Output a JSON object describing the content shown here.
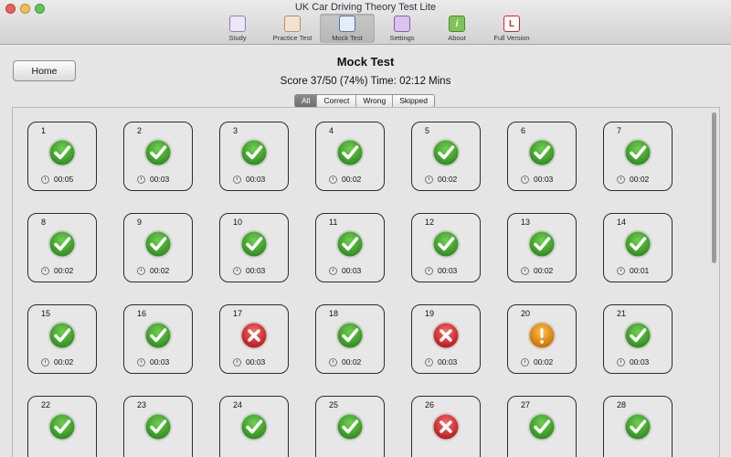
{
  "window": {
    "title": "UK Car Driving Theory Test Lite"
  },
  "toolbar": [
    {
      "label": "Study",
      "icon": "book-icon",
      "active": false
    },
    {
      "label": "Practice Test",
      "icon": "clipboard-icon",
      "active": false
    },
    {
      "label": "Mock Test",
      "icon": "stopwatch-icon",
      "active": true
    },
    {
      "label": "Settings",
      "icon": "gear-icon",
      "active": false
    },
    {
      "label": "About",
      "icon": "info-icon",
      "active": false
    },
    {
      "label": "Full Version",
      "icon": "learner-plate-icon",
      "active": false
    }
  ],
  "header": {
    "home_label": "Home",
    "title": "Mock Test",
    "score": "Score 37/50 (74%) Time: 02:12 Mins"
  },
  "filters": [
    {
      "label": "All",
      "selected": true
    },
    {
      "label": "Correct",
      "selected": false
    },
    {
      "label": "Wrong",
      "selected": false
    },
    {
      "label": "Skipped",
      "selected": false
    }
  ],
  "colors": {
    "correct": "#3a9a2a",
    "wrong": "#d62626",
    "skipped": "#e88b10"
  },
  "questions": [
    {
      "num": "1",
      "status": "correct",
      "time": "00:05"
    },
    {
      "num": "2",
      "status": "correct",
      "time": "00:03"
    },
    {
      "num": "3",
      "status": "correct",
      "time": "00:03"
    },
    {
      "num": "4",
      "status": "correct",
      "time": "00:02"
    },
    {
      "num": "5",
      "status": "correct",
      "time": "00:02"
    },
    {
      "num": "6",
      "status": "correct",
      "time": "00:03"
    },
    {
      "num": "7",
      "status": "correct",
      "time": "00:02"
    },
    {
      "num": "8",
      "status": "correct",
      "time": "00:02"
    },
    {
      "num": "9",
      "status": "correct",
      "time": "00:02"
    },
    {
      "num": "10",
      "status": "correct",
      "time": "00:03"
    },
    {
      "num": "11",
      "status": "correct",
      "time": "00:03"
    },
    {
      "num": "12",
      "status": "correct",
      "time": "00:03"
    },
    {
      "num": "13",
      "status": "correct",
      "time": "00:02"
    },
    {
      "num": "14",
      "status": "correct",
      "time": "00:01"
    },
    {
      "num": "15",
      "status": "correct",
      "time": "00:02"
    },
    {
      "num": "16",
      "status": "correct",
      "time": "00:03"
    },
    {
      "num": "17",
      "status": "wrong",
      "time": "00:03"
    },
    {
      "num": "18",
      "status": "correct",
      "time": "00:02"
    },
    {
      "num": "19",
      "status": "wrong",
      "time": "00:03"
    },
    {
      "num": "20",
      "status": "skipped",
      "time": "00:02"
    },
    {
      "num": "21",
      "status": "correct",
      "time": "00:03"
    },
    {
      "num": "22",
      "status": "correct",
      "time": ""
    },
    {
      "num": "23",
      "status": "correct",
      "time": ""
    },
    {
      "num": "24",
      "status": "correct",
      "time": ""
    },
    {
      "num": "25",
      "status": "correct",
      "time": ""
    },
    {
      "num": "26",
      "status": "wrong",
      "time": ""
    },
    {
      "num": "27",
      "status": "correct",
      "time": ""
    },
    {
      "num": "28",
      "status": "correct",
      "time": ""
    }
  ]
}
